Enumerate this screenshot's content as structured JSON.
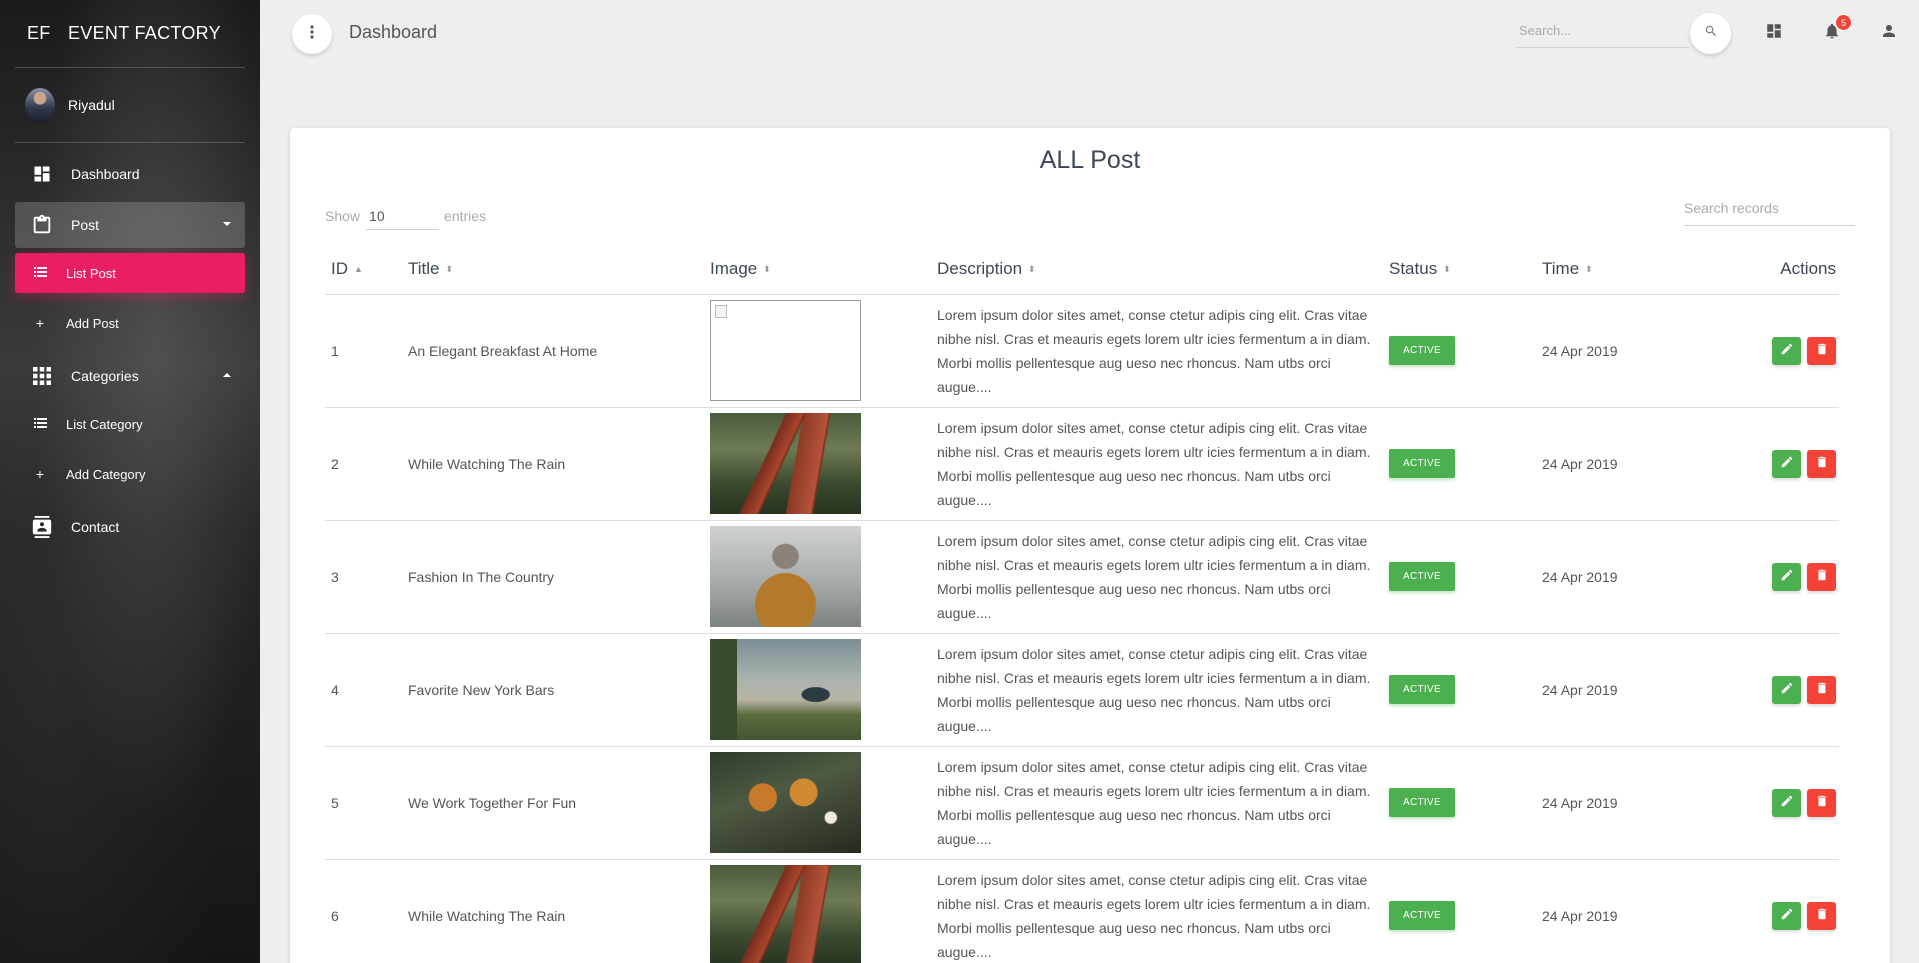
{
  "app": {
    "logo_mini": "EF",
    "logo_text": "EVENT FACTORY"
  },
  "user": {
    "name": "Riyadul"
  },
  "sidebar": {
    "dashboard": "Dashboard",
    "post": "Post",
    "list_post": "List Post",
    "add_post": "Add Post",
    "categories": "Categories",
    "list_category": "List Category",
    "add_category": "Add Category",
    "contact": "Contact"
  },
  "header": {
    "title": "Dashboard",
    "search_placeholder": "Search...",
    "notification_count": "5"
  },
  "card": {
    "title": "ALL Post",
    "show_label": "Show",
    "entries_value": "10",
    "entries_label": "entries",
    "search_placeholder": "Search records"
  },
  "table": {
    "columns": [
      "ID",
      "Title",
      "Image",
      "Description",
      "Status",
      "Time",
      "Actions"
    ],
    "rows": [
      {
        "id": "1",
        "title": "An Elegant Breakfast At Home",
        "image": "broken",
        "description": "Lorem ipsum dolor sites amet, conse ctetur adipis cing elit. Cras vitae nibhe nisl. Cras et meauris egets lorem ultr icies fermentum a in diam. Morbi mollis pellentesque aug ueso nec rhoncus. Nam utbs orci augue....",
        "status": "ACTIVE",
        "time": "24 Apr 2019"
      },
      {
        "id": "2",
        "title": "While Watching The Rain",
        "image": "bench",
        "description": "Lorem ipsum dolor sites amet, conse ctetur adipis cing elit. Cras vitae nibhe nisl. Cras et meauris egets lorem ultr icies fermentum a in diam. Morbi mollis pellentesque aug ueso nec rhoncus. Nam utbs orci augue....",
        "status": "ACTIVE",
        "time": "24 Apr 2019"
      },
      {
        "id": "3",
        "title": "Fashion In The Country",
        "image": "person",
        "description": "Lorem ipsum dolor sites amet, conse ctetur adipis cing elit. Cras vitae nibhe nisl. Cras et meauris egets lorem ultr icies fermentum a in diam. Morbi mollis pellentesque aug ueso nec rhoncus. Nam utbs orci augue....",
        "status": "ACTIVE",
        "time": "24 Apr 2019"
      },
      {
        "id": "4",
        "title": "Favorite New York Bars",
        "image": "walk",
        "description": "Lorem ipsum dolor sites amet, conse ctetur adipis cing elit. Cras vitae nibhe nisl. Cras et meauris egets lorem ultr icies fermentum a in diam. Morbi mollis pellentesque aug ueso nec rhoncus. Nam utbs orci augue....",
        "status": "ACTIVE",
        "time": "24 Apr 2019"
      },
      {
        "id": "5",
        "title": "We Work Together For Fun",
        "image": "pine",
        "description": "Lorem ipsum dolor sites amet, conse ctetur adipis cing elit. Cras vitae nibhe nisl. Cras et meauris egets lorem ultr icies fermentum a in diam. Morbi mollis pellentesque aug ueso nec rhoncus. Nam utbs orci augue....",
        "status": "ACTIVE",
        "time": "24 Apr 2019"
      },
      {
        "id": "6",
        "title": "While Watching The Rain",
        "image": "bench",
        "description": "Lorem ipsum dolor sites amet, conse ctetur adipis cing elit. Cras vitae nibhe nisl. Cras et meauris egets lorem ultr icies fermentum a in diam. Morbi mollis pellentesque aug ueso nec rhoncus. Nam utbs orci augue....",
        "status": "ACTIVE",
        "time": "24 Apr 2019"
      }
    ]
  },
  "colors": {
    "accent": "#e91e63",
    "success": "#4caf50",
    "danger": "#f44336"
  },
  "icons": [
    "dots-vertical-icon",
    "search-icon",
    "dashboard-icon",
    "bell-icon",
    "person-icon",
    "clipboard-icon",
    "list-icon",
    "plus-icon",
    "grid-icon",
    "contact-icon",
    "edit-icon",
    "delete-icon"
  ]
}
